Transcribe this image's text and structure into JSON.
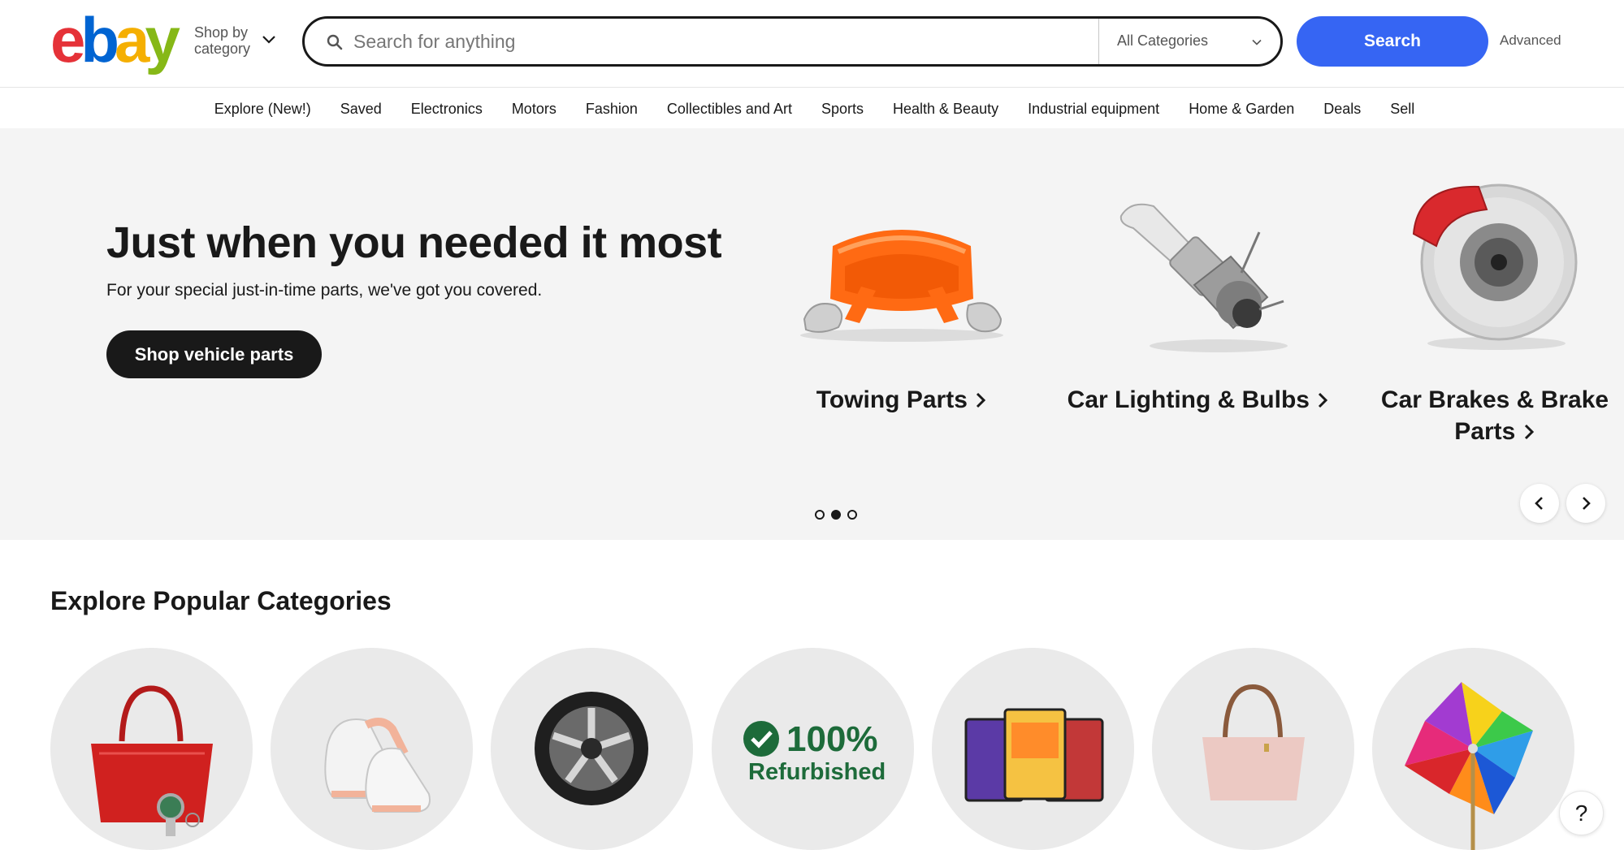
{
  "header": {
    "logo_letters": [
      "e",
      "b",
      "a",
      "y"
    ],
    "logo_colors": [
      "#e53238",
      "#0064d2",
      "#f5af02",
      "#86b817"
    ],
    "shop_by_category": "Shop by category",
    "search_placeholder": "Search for anything",
    "category_select": "All Categories",
    "search_button": "Search",
    "advanced": "Advanced"
  },
  "nav": {
    "items": [
      "Explore (New!)",
      "Saved",
      "Electronics",
      "Motors",
      "Fashion",
      "Collectibles and Art",
      "Sports",
      "Health & Beauty",
      "Industrial equipment",
      "Home & Garden",
      "Deals",
      "Sell"
    ]
  },
  "hero": {
    "title": "Just when you needed it most",
    "subtitle": "For your special just-in-time parts, we've got you covered.",
    "cta": "Shop vehicle parts",
    "cards": [
      {
        "label": "Towing Parts",
        "icon": "tow-strap-icon"
      },
      {
        "label": "Car Lighting & Bulbs",
        "icon": "headlight-bulb-icon"
      },
      {
        "label": "Car Brakes & Brake Parts",
        "icon": "brake-disc-icon"
      }
    ],
    "carousel_pages": 3,
    "carousel_active": 2
  },
  "popular": {
    "title": "Explore Popular Categories",
    "refurbished_badge": "100%",
    "refurbished_text": "Refurbished",
    "circles": [
      "handbag-watch-icon",
      "sneakers-icon",
      "wheel-icon",
      "refurbished-badge-icon",
      "trading-cards-icon",
      "tote-bag-icon",
      "pinwheel-icon"
    ]
  },
  "help": "?",
  "colors": {
    "accent": "#3665f3",
    "dark": "#191919",
    "hero_bg": "#f4f4f4"
  }
}
